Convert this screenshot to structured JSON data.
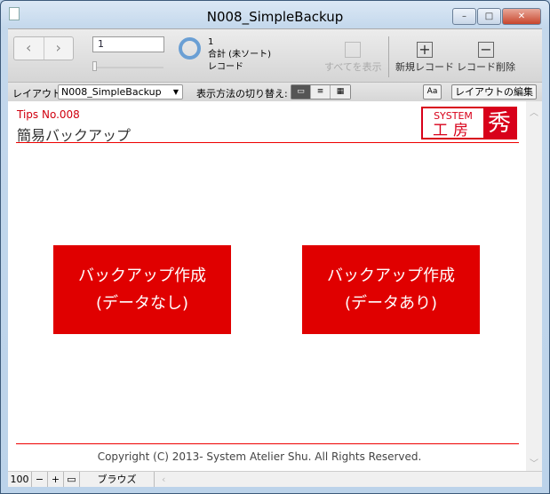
{
  "window": {
    "title": "N008_SimpleBackup",
    "min": "–",
    "max": "□",
    "close": "✕"
  },
  "toolbar": {
    "prev": "‹",
    "next": "›",
    "record_number": "1",
    "record_count": "1",
    "sort_status": "合計 (未ソート)",
    "records_label": "レコード",
    "show_all": "すべてを表示",
    "new_record": "新規レコード",
    "delete_record": "レコード削除"
  },
  "layoutbar": {
    "layout_label": "レイアウト:",
    "layout_value": "N008_SimpleBackup",
    "view_label": "表示方法の切り替え:",
    "aa": "Aa",
    "edit_layout": "レイアウトの編集"
  },
  "content": {
    "tips": "Tips No.008",
    "subtitle": "簡易バックアップ",
    "logo": {
      "system": "SYSTEM",
      "kobo": "工房",
      "shu": "秀"
    },
    "buttons": [
      {
        "line1": "バックアップ作成",
        "line2": "(データなし)"
      },
      {
        "line1": "バックアップ作成",
        "line2": "(データあり)"
      }
    ],
    "copyright": "Copyright (C) 2013- System Atelier Shu. All Rights Reserved."
  },
  "status": {
    "zoom": "100",
    "mode": "ブラウズ"
  },
  "colors": {
    "accent": "#e00000",
    "logo_red": "#d8001a",
    "progress_ring": "#6a9fd4"
  }
}
